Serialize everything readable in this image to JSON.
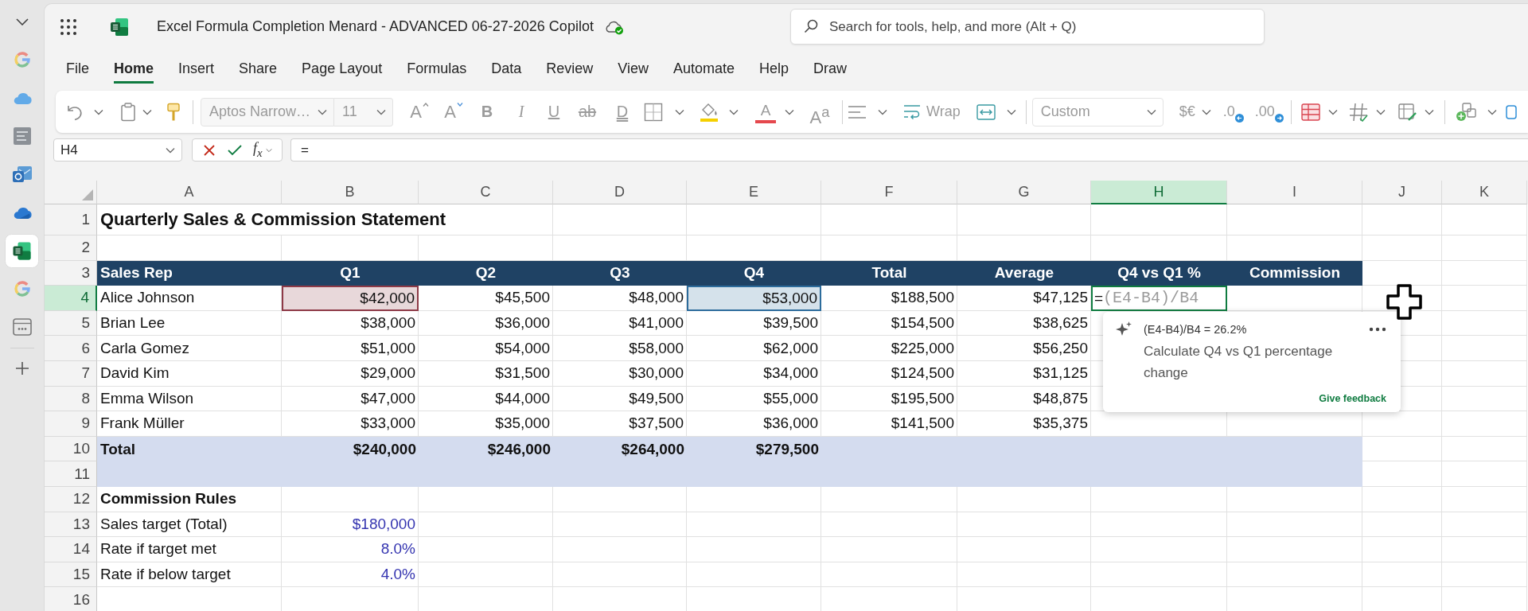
{
  "app_rail": {
    "items": [
      {
        "kind": "chevron",
        "selected": false
      },
      {
        "kind": "google",
        "selected": false
      },
      {
        "kind": "cloud",
        "selected": false
      },
      {
        "kind": "thumbnail",
        "selected": false
      },
      {
        "kind": "mail",
        "selected": false
      },
      {
        "kind": "drive",
        "selected": false
      },
      {
        "kind": "sheet",
        "selected": true
      },
      {
        "kind": "google",
        "selected": false
      },
      {
        "kind": "window",
        "selected": false
      },
      {
        "kind": "add",
        "selected": false
      }
    ]
  },
  "title_bar": {
    "title": "Excel Formula Completion Menard - ADVANCED 06-27-2026 Copilot",
    "search": {
      "placeholder": "Search for tools, help, and more (Alt + Q)"
    }
  },
  "menu_tabs": [
    {
      "label": "File",
      "selected": false
    },
    {
      "label": "Home",
      "selected": true
    },
    {
      "label": "Insert",
      "selected": false
    },
    {
      "label": "Share",
      "selected": false
    },
    {
      "label": "Page Layout",
      "selected": false
    },
    {
      "label": "Formulas",
      "selected": false
    },
    {
      "label": "Data",
      "selected": false
    },
    {
      "label": "Review",
      "selected": false
    },
    {
      "label": "View",
      "selected": false
    },
    {
      "label": "Automate",
      "selected": false
    },
    {
      "label": "Help",
      "selected": false
    },
    {
      "label": "Draw",
      "selected": false
    }
  ],
  "ribbon": {
    "disabled": true,
    "font_name": "Aptos Narrow…",
    "font_size": "11",
    "grow_font": "A",
    "shrink_font": "A",
    "bold": "B",
    "italic": "I",
    "underline": "U",
    "strikethrough": "ab",
    "double_underline": "D",
    "font_color": "A",
    "superscript": "A$^{a}$",
    "wrap": "Wrap",
    "number_format": "Custom",
    "currency": "$€",
    "increase_decimal": ".0",
    "decrease_decimal": ".00"
  },
  "formula_bar": {
    "name_box": "H4",
    "function": "f$_{x}$",
    "formula": "="
  },
  "sheet": {
    "columns": [
      {
        "label": "A",
        "selected": false
      },
      {
        "label": "B",
        "selected": false
      },
      {
        "label": "C",
        "selected": false
      },
      {
        "label": "D",
        "selected": false
      },
      {
        "label": "E",
        "selected": false
      },
      {
        "label": "F",
        "selected": false
      },
      {
        "label": "G",
        "selected": false
      },
      {
        "label": "H",
        "selected": true
      },
      {
        "label": "I",
        "selected": false
      },
      {
        "label": "J",
        "selected": false
      },
      {
        "label": "K",
        "selected": false
      }
    ],
    "rows": [
      {
        "number": "1",
        "selected": false,
        "kind": "title",
        "cells": [
          "Quarterly Sales & Commission Statement"
        ]
      },
      {
        "number": "2",
        "selected": false,
        "kind": "blank"
      },
      {
        "number": "3",
        "selected": false,
        "kind": "header",
        "cells": [
          "Sales Rep",
          "Q1",
          "Q2",
          "Q3",
          "Q4",
          "Total",
          "Average",
          "Q4 vs Q1 %",
          "Commission"
        ]
      },
      {
        "number": "4",
        "selected": true,
        "kind": "data",
        "cells": [
          "Alice Johnson",
          {
            "text": "$42,000",
            "color": "#8e3a47"
          },
          "$45,500",
          "$48,000",
          {
            "text": "$53,000",
            "color": "#2d6c9c"
          },
          "$188,500",
          "$47,125",
          {
            "kind": "edit",
            "text": "=",
            "ghost_text": "(E4-B4)/B4"
          }
        ]
      },
      {
        "number": "5",
        "selected": false,
        "kind": "data",
        "cells": [
          "Brian Lee",
          "$38,000",
          "$36,000",
          "$41,000",
          "$39,500",
          "$154,500",
          "$38,625"
        ]
      },
      {
        "number": "6",
        "selected": false,
        "kind": "data",
        "cells": [
          "Carla Gomez",
          "$51,000",
          "$54,000",
          "$58,000",
          "$62,000",
          "$225,000",
          "$56,250"
        ]
      },
      {
        "number": "7",
        "selected": false,
        "kind": "data",
        "cells": [
          "David Kim",
          "$29,000",
          "$31,500",
          "$30,000",
          "$34,000",
          "$124,500",
          "$31,125"
        ]
      },
      {
        "number": "8",
        "selected": false,
        "kind": "data",
        "cells": [
          "Emma Wilson",
          "$47,000",
          "$44,000",
          "$49,500",
          "$55,000",
          "$195,500",
          "$48,875"
        ]
      },
      {
        "number": "9",
        "selected": false,
        "kind": "data",
        "cells": [
          "Frank Müller",
          "$33,000",
          "$35,000",
          "$37,500",
          "$36,000",
          "$141,500",
          "$35,375"
        ]
      },
      {
        "number": "10",
        "selected": false,
        "kind": "total",
        "cells": [
          "Total",
          "$240,000",
          "$246,000",
          "$264,000",
          "$279,500"
        ]
      },
      {
        "number": "11",
        "selected": false,
        "kind": "band"
      },
      {
        "number": "12",
        "selected": false,
        "kind": "section",
        "cells": [
          "Commission Rules"
        ]
      },
      {
        "number": "13",
        "selected": false,
        "kind": "input",
        "cells": [
          "Sales target (Total)",
          "$180,000"
        ]
      },
      {
        "number": "14",
        "selected": false,
        "kind": "input",
        "cells": [
          "Rate if target met",
          "8.0%"
        ]
      },
      {
        "number": "15",
        "selected": false,
        "kind": "input",
        "cells": [
          "Rate if below target",
          "4.0%"
        ]
      },
      {
        "number": "16",
        "selected": false,
        "kind": "blank"
      }
    ]
  },
  "suggestion": {
    "formula": "(E4-B4)/B4 = 26.2%",
    "description": "Calculate Q4 vs Q1 percentage change",
    "link": "Give feedback"
  }
}
